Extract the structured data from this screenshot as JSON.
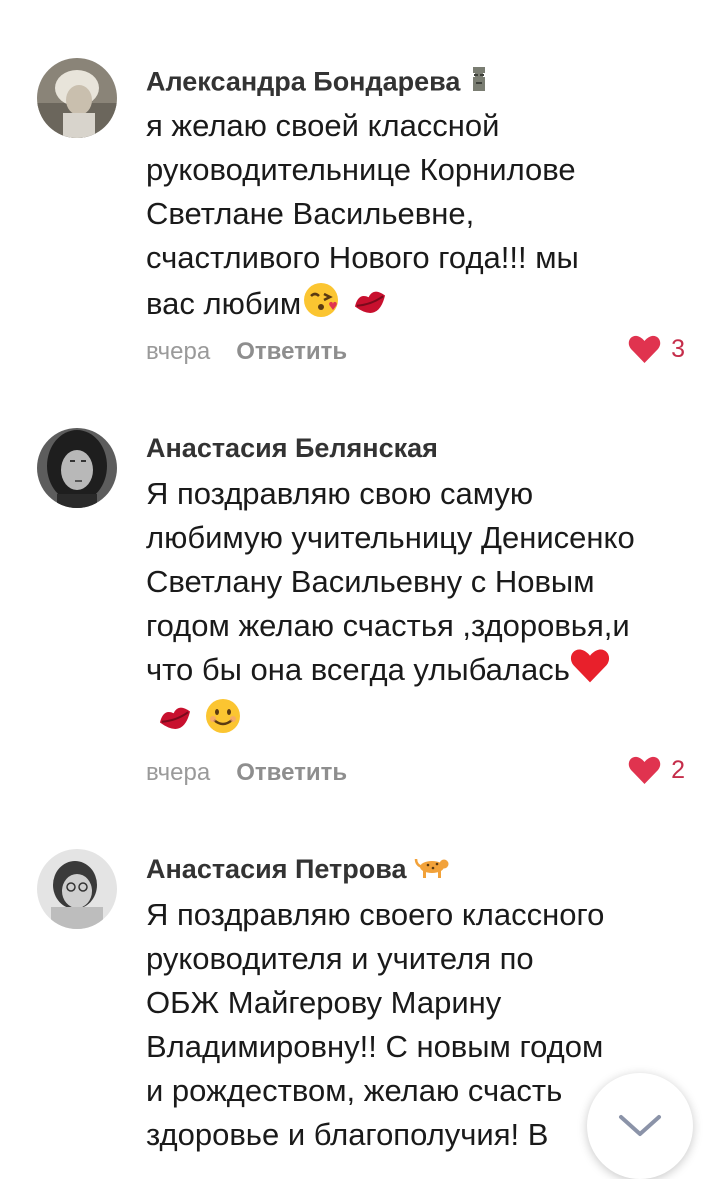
{
  "comments": [
    {
      "author": "Александра Бондарева",
      "text": "я желаю своей классной\nруководительнице Корнилове\nСветлане Васильевне,\nсчастливого Нового года!!! мы\nвас любим",
      "emojis": [
        "moai-icon",
        "kissing-face-icon",
        "kiss-lips-icon"
      ],
      "time": "вчера",
      "reply": "Ответить",
      "likes": "3"
    },
    {
      "author": "Анастасия Белянская",
      "text": "Я поздравляю свою самую\nлюбимую учительницу Денисенко\nСветлану Васильевну с Новым\nгодом желаю счастья  ,здоровья,и\nчто бы она всегда улыбалась",
      "emojis": [
        "red-heart-icon",
        "kiss-lips-icon",
        "smiling-face-icon"
      ],
      "time": "вчера",
      "reply": "Ответить",
      "likes": "2"
    },
    {
      "author": "Анастасия Петрова",
      "text": "Я поздравляю своего классного\nруководителя и учителя по\nОБЖ Майгерову Марину\nВладимировну!! С новым годом\nи рождеством, желаю счасть\nздоровье и  благополучия! В",
      "emojis": [
        "leopard-icon"
      ]
    }
  ],
  "colors": {
    "like": "#e0334f",
    "accent_text": "#8e8e8e"
  }
}
